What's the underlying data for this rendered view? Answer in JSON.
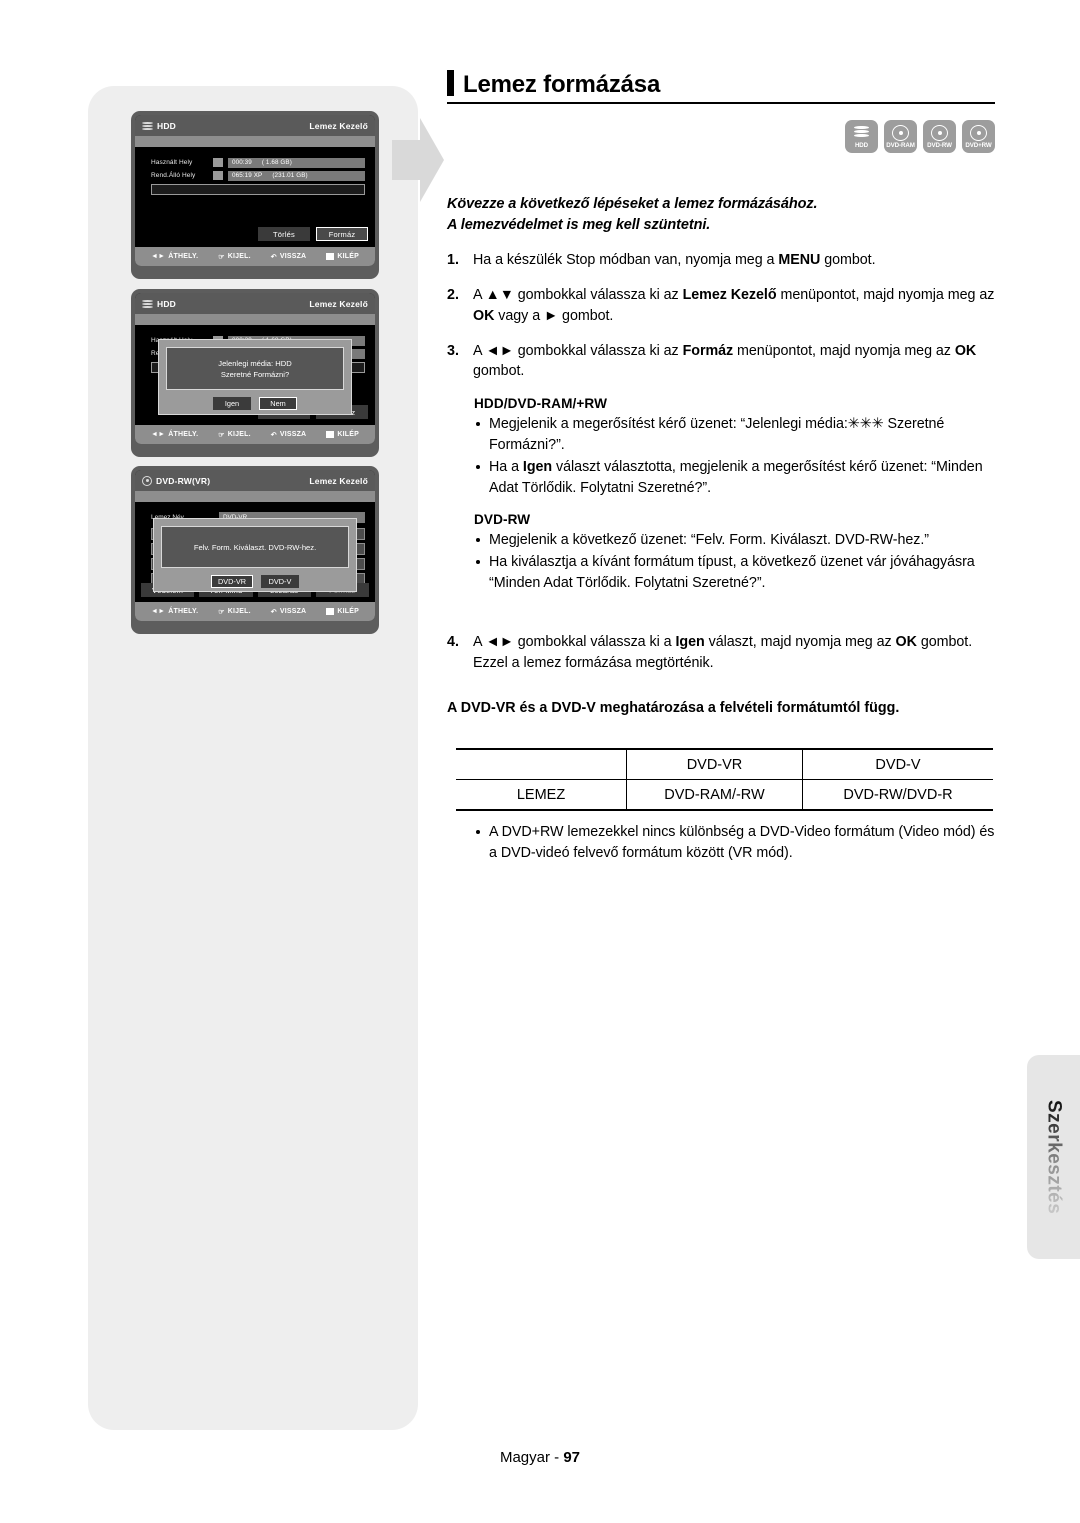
{
  "page": {
    "title": "Lemez formázása",
    "footer_label": "Magyar -",
    "footer_page": "97",
    "side_tab": "Szerkesztés"
  },
  "media_icons": [
    {
      "name": "hdd-icon",
      "label": "HDD"
    },
    {
      "name": "dvd-ram-icon",
      "label": "DVD-RAM"
    },
    {
      "name": "dvd-rw-icon",
      "label": "DVD-RW"
    },
    {
      "name": "dvd-plus-rw-icon",
      "label": "DVD+RW"
    }
  ],
  "intro": {
    "line1": "Kövezze a következő lépéseket a lemez formázásához.",
    "line2": "A lemezvédelmet is meg kell szüntetni."
  },
  "steps": [
    {
      "num": "1.",
      "html": "Ha a készülék Stop módban van, nyomja meg a <b>MENU</b> gombot."
    },
    {
      "num": "2.",
      "html": "A ▲▼ gombokkal válassza ki az <b>Lemez Kezelő</b> menüpontot, majd nyomja meg az <b>OK</b> vagy a ► gombot."
    },
    {
      "num": "3.",
      "html": "A ◄► gombokkal válassza ki az <b>Formáz</b> menüpontot, majd nyomja meg az <b>OK</b> gombot."
    }
  ],
  "blocks": [
    {
      "heading": "HDD/DVD-RAM/+RW",
      "bullets": [
        "Megjelenik a megerősítést kérő üzenet: “Jelenlegi média:✳✳✳ Szeretné Formázni?”.",
        "Ha a <b>Igen</b> választ választotta, megjelenik a megerősítést kérő üzenet: “Minden Adat Törlődik. Folytatni Szeretné?”."
      ]
    },
    {
      "heading": "DVD-RW",
      "bullets": [
        "Megjelenik a következő üzenet: “Felv. Form. Kiválaszt. DVD-RW-hez.”",
        "Ha kiválasztja a kívánt formátum típust, a következő üzenet vár jóváhagyásra “Minden Adat Törlődik. Folytatni Szeretné?”."
      ]
    }
  ],
  "step4": {
    "num": "4.",
    "html": "A ◄► gombokkal válassza ki a <b>Igen</b> választ, majd nyomja meg az <b>OK</b> gombot. Ezzel a lemez formázása megtörténik."
  },
  "table_heading": "A DVD-VR és a DVD-V meghatározása a felvételi formátumtól függ.",
  "table": {
    "header": [
      "",
      "DVD-VR",
      "DVD-V"
    ],
    "rows": [
      [
        "LEMEZ",
        "DVD-RAM/-RW",
        "DVD-RW/DVD-R"
      ]
    ]
  },
  "final_note": "A DVD+RW lemezekkel nincs különbség a DVD-Video formátum (Video mód) és a DVD-videó felvevő formátum között (VR mód).",
  "osd_nav": [
    {
      "icon": "◄►",
      "label": "ÁTHELY."
    },
    {
      "icon": "@",
      "label": "KIJEL."
    },
    {
      "icon": "↶",
      "label": "VISSZA"
    },
    {
      "icon": "▭",
      "label": "KILÉP"
    }
  ],
  "screen1": {
    "title": "HDD",
    "title_right": "Lemez Kezelő",
    "rows": [
      {
        "label": "Használt Hely",
        "v1": "000:39",
        "v2": "( 1.68 GB)"
      },
      {
        "label": "Rend.Álló Hely",
        "v1": "065:19 XP",
        "v2": "(231.01 GB)"
      }
    ],
    "buttons": [
      {
        "label": "Törlés",
        "selected": false
      },
      {
        "label": "Formáz",
        "selected": true
      }
    ]
  },
  "screen2": {
    "title": "HDD",
    "title_right": "Lemez Kezelő",
    "dialog_line1": "Jelenlegi média: HDD",
    "dialog_line2": "Szeretné Formázni?",
    "dialog_buttons": [
      {
        "label": "Igen",
        "selected": false
      },
      {
        "label": "Nem",
        "selected": true
      }
    ],
    "buttons": [
      {
        "label": "Törlés",
        "selected": false
      },
      {
        "label": "Formáz",
        "selected": false
      }
    ]
  },
  "screen3": {
    "title": "DVD-RW(VR)",
    "title_right": "Lemez Kezelő",
    "name_label": "Lemez Név",
    "name_value": "DVD-VR",
    "dialog_line1": "Felv. Form. Kiválaszt. DVD-RW-hez.",
    "dialog_buttons": [
      {
        "label": "DVD-VR",
        "selected": true
      },
      {
        "label": "DVD-V",
        "selected": false
      }
    ],
    "buttons": [
      {
        "label": "Védelem",
        "selected": false
      },
      {
        "label": "Tör. Mind",
        "selected": false
      },
      {
        "label": "Lezárás",
        "selected": false
      },
      {
        "label": "Formáz",
        "selected": false,
        "dim": true
      }
    ]
  },
  "colors": {
    "panel_gray": "#eeeeee",
    "osd_frame": "#5d5d5d",
    "osd_body": "#000000",
    "osd_nav": "#8e8e8e",
    "media_badge": "#9d9d9d"
  }
}
